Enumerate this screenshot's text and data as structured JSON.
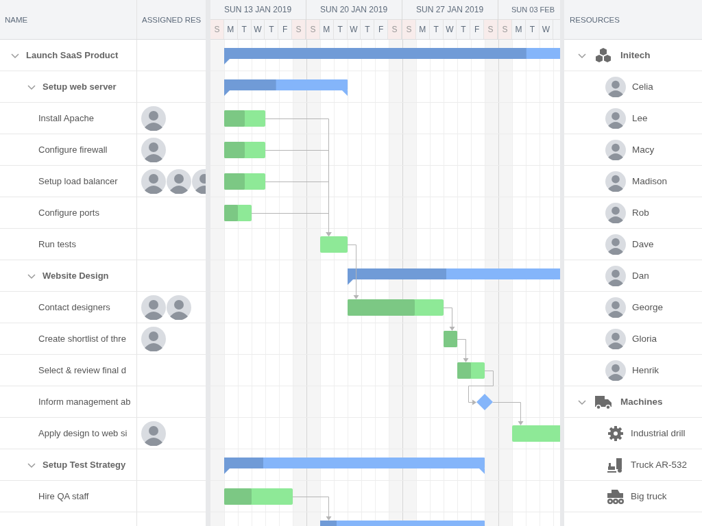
{
  "columns": {
    "name": "NAME",
    "assigned": "ASSIGNED RES"
  },
  "timeline": {
    "weeks": [
      {
        "label": "SUN 13 JAN 2019",
        "days": [
          {
            "label": "S",
            "weekend": true
          },
          {
            "label": "M",
            "weekend": false
          },
          {
            "label": "T",
            "weekend": false
          },
          {
            "label": "W",
            "weekend": false
          },
          {
            "label": "T",
            "weekend": false
          },
          {
            "label": "F",
            "weekend": false
          },
          {
            "label": "S",
            "weekend": true
          }
        ]
      },
      {
        "label": "SUN 20 JAN 2019",
        "days": [
          {
            "label": "S",
            "weekend": true
          },
          {
            "label": "M",
            "weekend": false
          },
          {
            "label": "T",
            "weekend": false
          },
          {
            "label": "W",
            "weekend": false
          },
          {
            "label": "T",
            "weekend": false
          },
          {
            "label": "F",
            "weekend": false
          },
          {
            "label": "S",
            "weekend": true
          }
        ]
      },
      {
        "label": "SUN 27 JAN 2019",
        "days": [
          {
            "label": "S",
            "weekend": true
          },
          {
            "label": "M",
            "weekend": false
          },
          {
            "label": "T",
            "weekend": false
          },
          {
            "label": "W",
            "weekend": false
          },
          {
            "label": "T",
            "weekend": false
          },
          {
            "label": "F",
            "weekend": false
          },
          {
            "label": "S",
            "weekend": true
          }
        ]
      },
      {
        "label": "SUN 03 FEB",
        "days": [
          {
            "label": "S",
            "weekend": true
          },
          {
            "label": "M",
            "weekend": false
          },
          {
            "label": "T",
            "weekend": false
          },
          {
            "label": "W",
            "weekend": false
          }
        ]
      }
    ]
  },
  "tasks": [
    {
      "name": "Launch SaaS Product",
      "kind": "summary",
      "expanded": true,
      "level": 0.76,
      "children": [
        {
          "name": "Setup web server",
          "kind": "summary",
          "expanded": true,
          "level": 0.42,
          "children": [
            {
              "name": "Install Apache",
              "kind": "task",
              "level": 0.5,
              "assignees": [
                {
                  "kind": "person"
                }
              ]
            },
            {
              "name": "Configure firewall",
              "kind": "task",
              "level": 0.5,
              "assignees": [
                {
                  "kind": "person"
                }
              ]
            },
            {
              "name": "Setup load balancer",
              "kind": "task",
              "level": 0.5,
              "assignees": [
                {
                  "kind": "person"
                },
                {
                  "kind": "person"
                },
                {
                  "kind": "person"
                }
              ]
            },
            {
              "name": "Configure ports",
              "kind": "task",
              "level": 0.5
            },
            {
              "name": "Run tests",
              "kind": "task"
            }
          ]
        },
        {
          "name": "Website Design",
          "kind": "summary",
          "expanded": true,
          "level": 0.4,
          "children": [
            {
              "name": "Contact designers",
              "kind": "task",
              "level": 0.7,
              "assignees": [
                {
                  "kind": "person"
                },
                {
                  "kind": "person"
                }
              ]
            },
            {
              "name": "Create shortlist of thre",
              "kind": "task",
              "level": 1,
              "assignees": [
                {
                  "kind": "person"
                }
              ]
            },
            {
              "name": "Select & review final d",
              "kind": "task",
              "level": 0.5
            },
            {
              "name": "Inform management ab",
              "kind": "milestone"
            },
            {
              "name": "Apply design to web si",
              "kind": "task",
              "assignees": [
                {
                  "kind": "person"
                }
              ]
            }
          ]
        },
        {
          "name": "Setup Test Strategy",
          "kind": "summary",
          "expanded": true,
          "level": 0.15,
          "children": [
            {
              "name": "Hire QA staff",
              "kind": "task",
              "level": 0.4
            },
            {
              "kind": "summary",
              "level": 0.1
            }
          ]
        }
      ]
    }
  ],
  "resources": {
    "title": "RESOURCES",
    "groups": [
      {
        "name": "Initech",
        "kind": "company",
        "expanded": true,
        "children": [
          {
            "name": "Celia",
            "kind": "person"
          },
          {
            "name": "Lee",
            "kind": "person"
          },
          {
            "name": "Macy",
            "kind": "person"
          },
          {
            "name": "Madison",
            "kind": "person"
          },
          {
            "name": "Rob",
            "kind": "person"
          },
          {
            "name": "Dave",
            "kind": "person"
          },
          {
            "name": "Dan",
            "kind": "person"
          },
          {
            "name": "George",
            "kind": "person"
          },
          {
            "name": "Gloria",
            "kind": "person"
          },
          {
            "name": "Henrik",
            "kind": "person"
          }
        ]
      },
      {
        "name": "Machines",
        "kind": "vehicles",
        "expanded": true,
        "children": [
          {
            "name": "Industrial drill",
            "kind": "gear"
          },
          {
            "name": "Truck AR-532",
            "kind": "forklift"
          },
          {
            "name": "Big truck",
            "kind": "bigtruck"
          }
        ]
      }
    ]
  }
}
